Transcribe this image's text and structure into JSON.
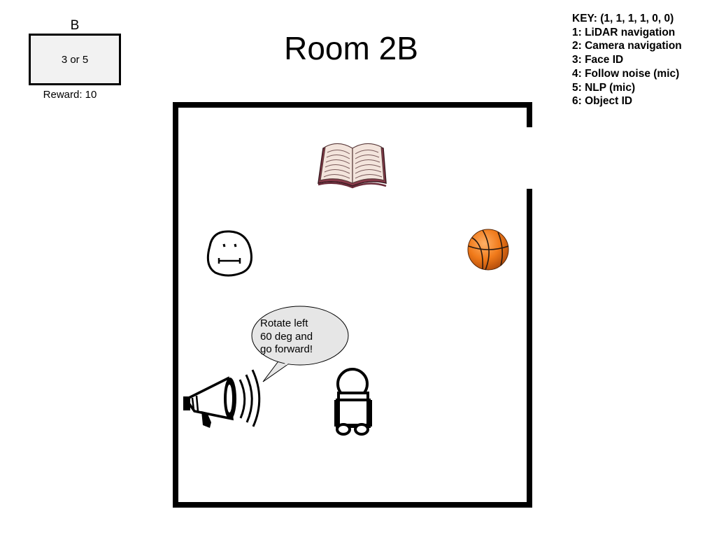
{
  "title": "Room 2B",
  "box": {
    "letter": "B",
    "value": "3 or 5",
    "reward": "Reward:  10"
  },
  "key": {
    "header": "KEY: (1, 1, 1, 1, 0, 0)",
    "items": [
      "1: LiDAR navigation",
      "2: Camera navigation",
      "3: Face ID",
      "4: Follow noise (mic)",
      "5: NLP (mic)",
      "6: Object ID"
    ]
  },
  "speech": {
    "lines": [
      "Rotate left",
      "60 deg and",
      "go forward!"
    ]
  },
  "colors": {
    "wall": "#000000",
    "box_fill": "#f2f2f2",
    "bubble_fill": "#e6e6e6",
    "basketball": "#f07a1a",
    "book_page": "#f3e4dc",
    "book_cover": "#8a3a4a"
  },
  "icons": [
    "book-icon",
    "face-icon",
    "basketball-icon",
    "megaphone-icon",
    "robot-icon",
    "speech-bubble"
  ]
}
